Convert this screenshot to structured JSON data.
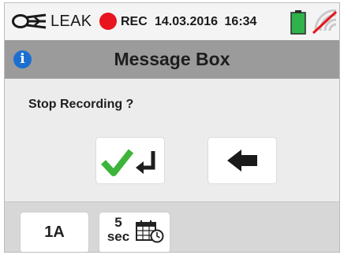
{
  "status_bar": {
    "mode": "LEAK",
    "rec_label": "REC",
    "date": "14.03.2016",
    "time": "16:34",
    "icons": [
      "clamp-icon",
      "rec-indicator",
      "battery-icon",
      "wifi-disabled-icon"
    ],
    "colors": {
      "rec": "#e8141e",
      "battery": "#2fb34a",
      "wifi_off": "#e8141e"
    }
  },
  "dialog": {
    "title": "Message Box",
    "info_icon_glyph": "i",
    "message": "Stop Recording ?",
    "buttons": [
      {
        "name": "confirm",
        "icon": "checkmark-enter-icon"
      },
      {
        "name": "back",
        "icon": "arrow-left-icon"
      }
    ]
  },
  "bottom_bar": {
    "range_label": "1A",
    "interval_value": "5",
    "interval_unit": "sec",
    "interval_icon": "calendar-clock-icon"
  }
}
